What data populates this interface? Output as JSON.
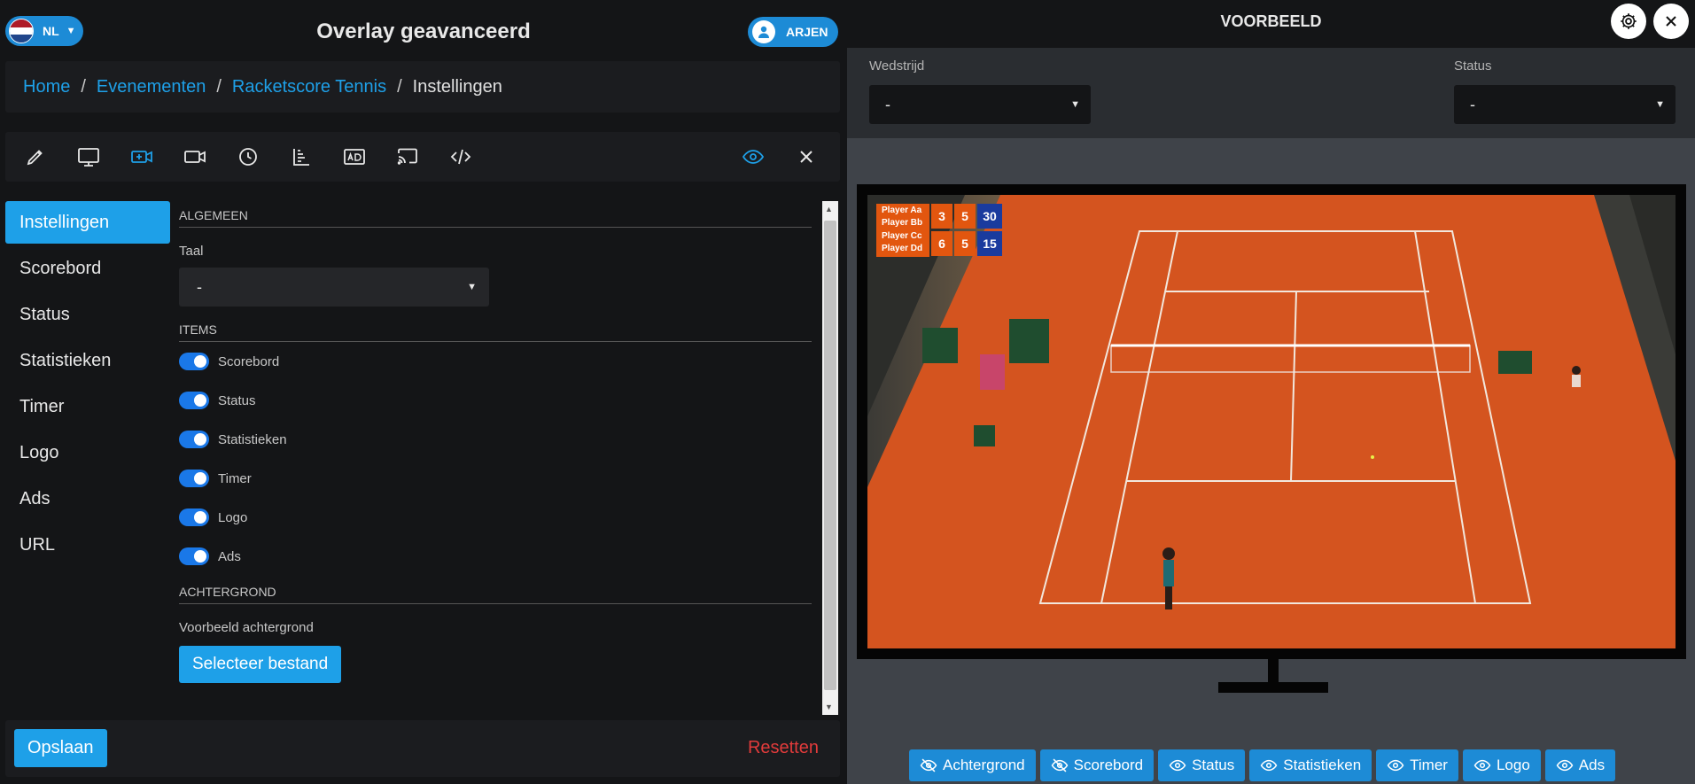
{
  "header": {
    "lang": "NL",
    "title": "Overlay geavanceerd",
    "user": "ARJEN"
  },
  "breadcrumb": {
    "home": "Home",
    "events": "Evenementen",
    "event": "Racketscore Tennis",
    "current": "Instellingen",
    "sep": "/"
  },
  "sidebar": {
    "items": [
      {
        "label": "Instellingen"
      },
      {
        "label": "Scorebord"
      },
      {
        "label": "Status"
      },
      {
        "label": "Statistieken"
      },
      {
        "label": "Timer"
      },
      {
        "label": "Logo"
      },
      {
        "label": "Ads"
      },
      {
        "label": "URL"
      }
    ]
  },
  "settings": {
    "general_heading": "ALGEMEEN",
    "language_label": "Taal",
    "language_value": "-",
    "items_heading": "ITEMS",
    "toggles": [
      {
        "label": "Scorebord",
        "on": true
      },
      {
        "label": "Status",
        "on": true
      },
      {
        "label": "Statistieken",
        "on": true
      },
      {
        "label": "Timer",
        "on": true
      },
      {
        "label": "Logo",
        "on": true
      },
      {
        "label": "Ads",
        "on": true
      }
    ],
    "background_heading": "ACHTERGROND",
    "preview_bg_label": "Voorbeeld achtergrond",
    "select_file": "Selecteer bestand"
  },
  "footer": {
    "save": "Opslaan",
    "reset": "Resetten"
  },
  "preview": {
    "title": "VOORBEELD",
    "match_label": "Wedstrijd",
    "match_value": "-",
    "status_label": "Status",
    "status_value": "-"
  },
  "scoreboard": {
    "team1": {
      "p1": "Player Aa",
      "p2": "Player Bb",
      "set1": "3",
      "set2": "5",
      "points": "30"
    },
    "team2": {
      "p1": "Player Cc",
      "p2": "Player Dd",
      "set1": "6",
      "set2": "5",
      "points": "15"
    }
  },
  "visibility_buttons": [
    {
      "label": "Achtergrond",
      "visible": false
    },
    {
      "label": "Scorebord",
      "visible": false
    },
    {
      "label": "Status",
      "visible": true
    },
    {
      "label": "Statistieken",
      "visible": true
    },
    {
      "label": "Timer",
      "visible": true
    },
    {
      "label": "Logo",
      "visible": true
    },
    {
      "label": "Ads",
      "visible": true
    }
  ],
  "colors": {
    "accent": "#1ea0e8",
    "danger": "#e23b3b",
    "panel": "#1b1c1f",
    "court": "#d4521e",
    "scoreboard_orange": "#e2560f",
    "scoreboard_blue": "#1a3b9e"
  },
  "icons": [
    "pencil-icon",
    "monitor-icon",
    "camera-plus-icon",
    "video-icon",
    "clock-icon",
    "bar-chart-icon",
    "ad-icon",
    "cast-icon",
    "code-icon",
    "eye-icon",
    "close-icon",
    "gear-icon"
  ]
}
